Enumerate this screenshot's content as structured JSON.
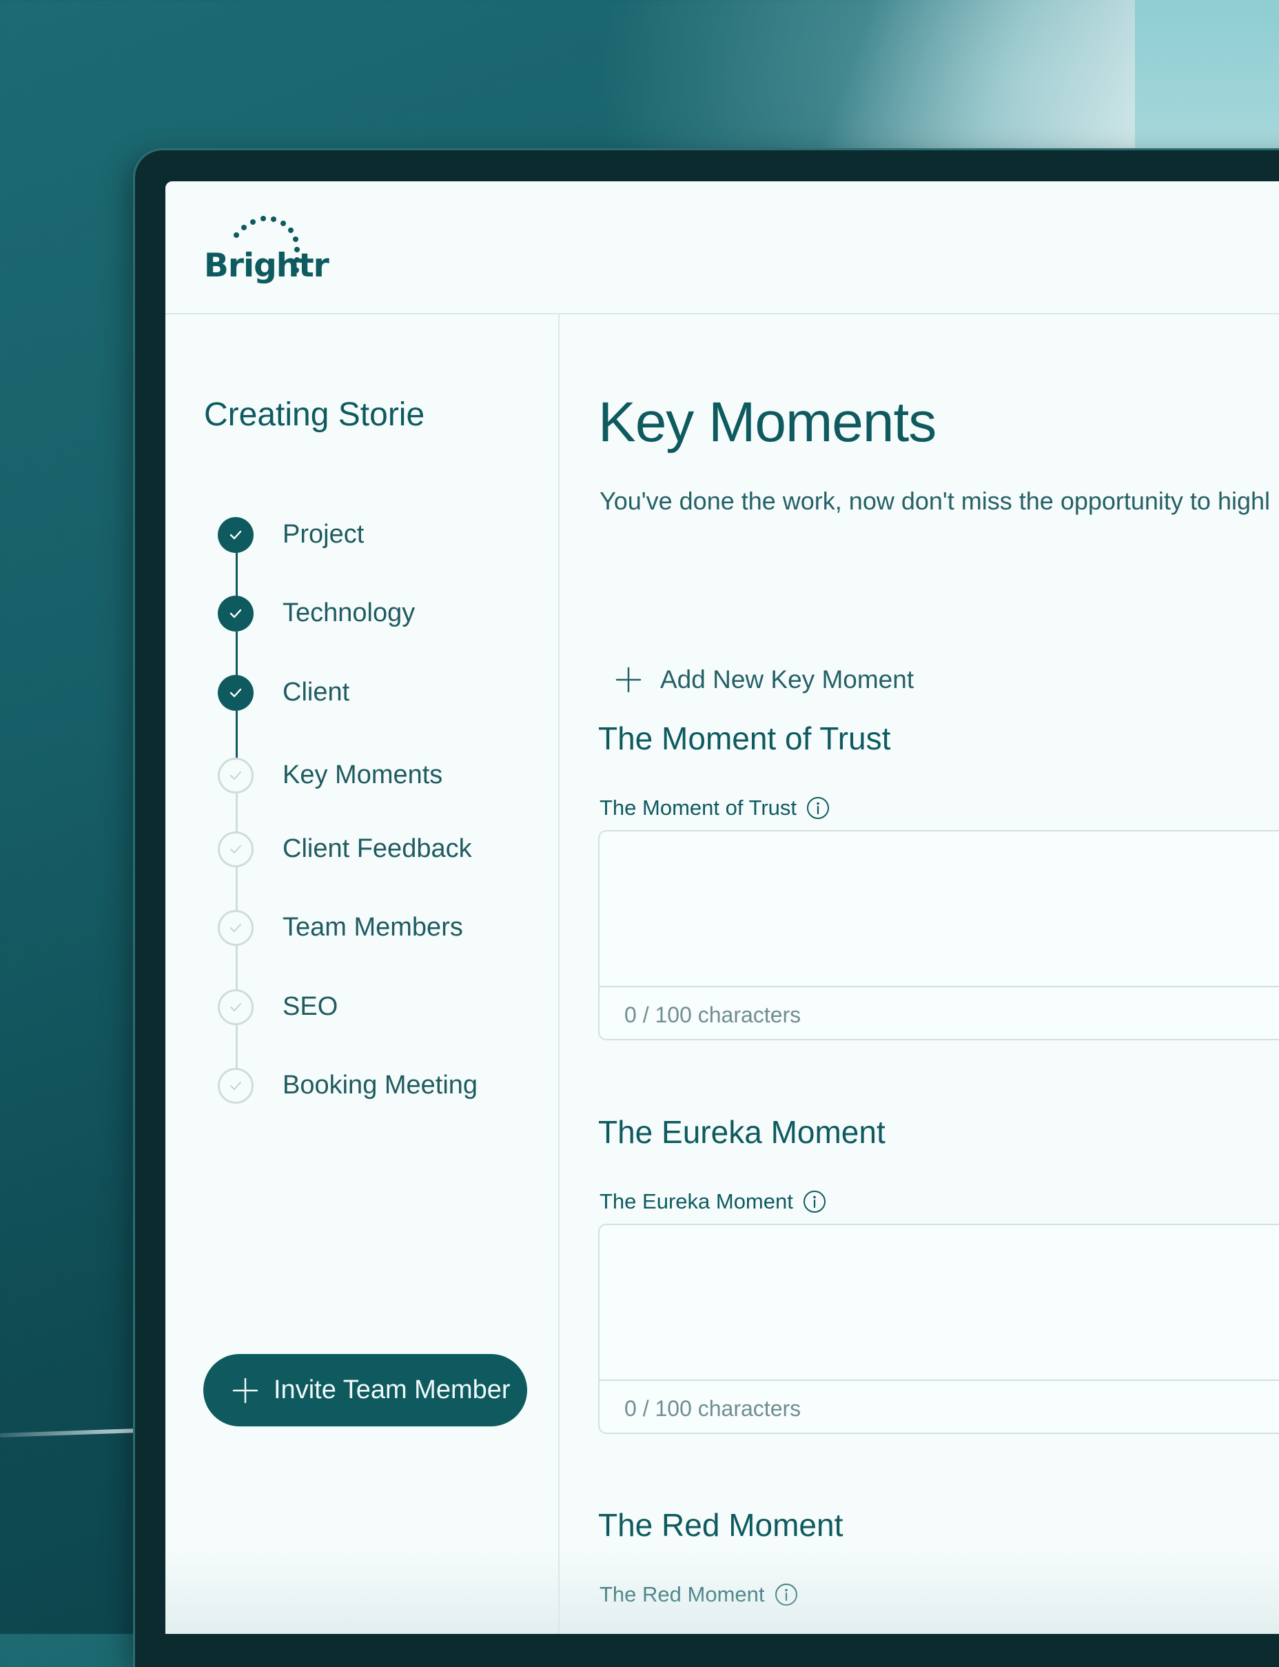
{
  "app": {
    "logo_text": "Brightr"
  },
  "sidebar": {
    "title": "Creating Storie",
    "steps": [
      {
        "label": "Project",
        "status": "done"
      },
      {
        "label": "Technology",
        "status": "done"
      },
      {
        "label": "Client",
        "status": "done"
      },
      {
        "label": "Key Moments",
        "status": "todo"
      },
      {
        "label": "Client Feedback",
        "status": "todo"
      },
      {
        "label": "Team Members",
        "status": "todo"
      },
      {
        "label": "SEO",
        "status": "todo"
      },
      {
        "label": "Booking Meeting",
        "status": "todo"
      }
    ],
    "invite_button_label": "Invite Team Member"
  },
  "main": {
    "title": "Key Moments",
    "subtitle": "You've done the work, now don't miss the opportunity to highl",
    "add_button_label": "Add New Key Moment",
    "moments": [
      {
        "heading": "The Moment of Trust",
        "field_label": "The Moment of Trust",
        "char_count": "0 / 100 characters"
      },
      {
        "heading": "The Eureka Moment",
        "field_label": "The Eureka Moment",
        "char_count": "0 / 100 characters"
      },
      {
        "heading": "The Red Moment",
        "field_label": "The Red Moment"
      }
    ]
  },
  "colors": {
    "brand": "#0e5a5f",
    "screen_bg": "#f6fcfc",
    "step_done": "#0e5a5f",
    "step_todo_border": "#cfdcdc",
    "muted_text": "#6f8e91"
  }
}
